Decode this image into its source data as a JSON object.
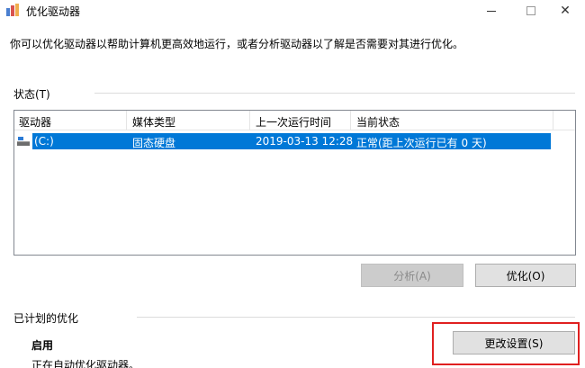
{
  "window": {
    "title": "优化驱动器",
    "min_glyph": "",
    "max_glyph": "",
    "close_glyph": "✕"
  },
  "description": "你可以优化驱动器以帮助计算机更高效地运行，或者分析驱动器以了解是否需要对其进行优化。",
  "status_section": {
    "label": "状态(T)",
    "columns": [
      "驱动器",
      "媒体类型",
      "上一次运行时间",
      "当前状态"
    ],
    "rows": [
      {
        "drive": "(C:)",
        "media_type": "固态硬盘",
        "last_run": "2019-03-13 12:28",
        "status": "正常(距上次运行已有 0 天)",
        "selected": true
      }
    ]
  },
  "buttons": {
    "analyze": "分析(A)",
    "optimize": "优化(O)",
    "change_settings": "更改设置(S)"
  },
  "scheduled_section": {
    "label": "已计划的优化",
    "state": "启用",
    "detail": "正在自动优化驱动器。"
  },
  "colors": {
    "selection": "#0078d7",
    "highlight_box": "#e02020"
  }
}
